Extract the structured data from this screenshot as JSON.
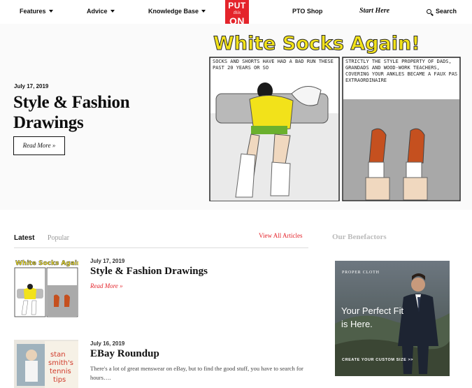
{
  "nav": {
    "features": "Features",
    "advice": "Advice",
    "knowledge_base": "Knowledge Base",
    "logo": {
      "put": "PUT",
      "this": "this",
      "on": "ON"
    },
    "shop": "PTO Shop",
    "start_here": "Start Here",
    "search": "Search"
  },
  "hero": {
    "date": "July 17, 2019",
    "title": "Style & Fashion Drawings",
    "button": "Read More »",
    "comic": {
      "title": "White Socks Again!",
      "panel1_caption": "SOCKS AND SHORTS HAVE HAD A BAD RUN THESE PAST 20 YEARS OR SO",
      "panel2_caption": "STRICTLY THE STYLE PROPERTY OF DADS, GRANDADS AND WOOD-WORK TEACHERS, COVERING YOUR ANKLES BECAME A FAUX PAS EXTRAORDINAIRE"
    }
  },
  "list": {
    "tabs": [
      "Latest",
      "Popular"
    ],
    "view_all": "View All Articles",
    "articles": [
      {
        "date": "July 17, 2019",
        "title": "Style & Fashion Drawings",
        "more": "Read More »"
      },
      {
        "date": "July 16, 2019",
        "title": "EBay Roundup",
        "excerpt": "There's a lot of great menswear on eBay, but to find the good stuff, you have to search for hours…."
      }
    ],
    "thumb2_text": [
      "stan",
      "smith's",
      "tennis",
      "tips"
    ]
  },
  "benefactors": {
    "title": "Our Benefactors",
    "ad": {
      "brand": "PROPER CLOTH",
      "headline": "Your Perfect Fit is Here.",
      "cta": "CREATE YOUR CUSTOM SIZE  >>"
    }
  },
  "colors": {
    "accent": "#e4242b",
    "comic_yellow": "#f2e21a"
  }
}
